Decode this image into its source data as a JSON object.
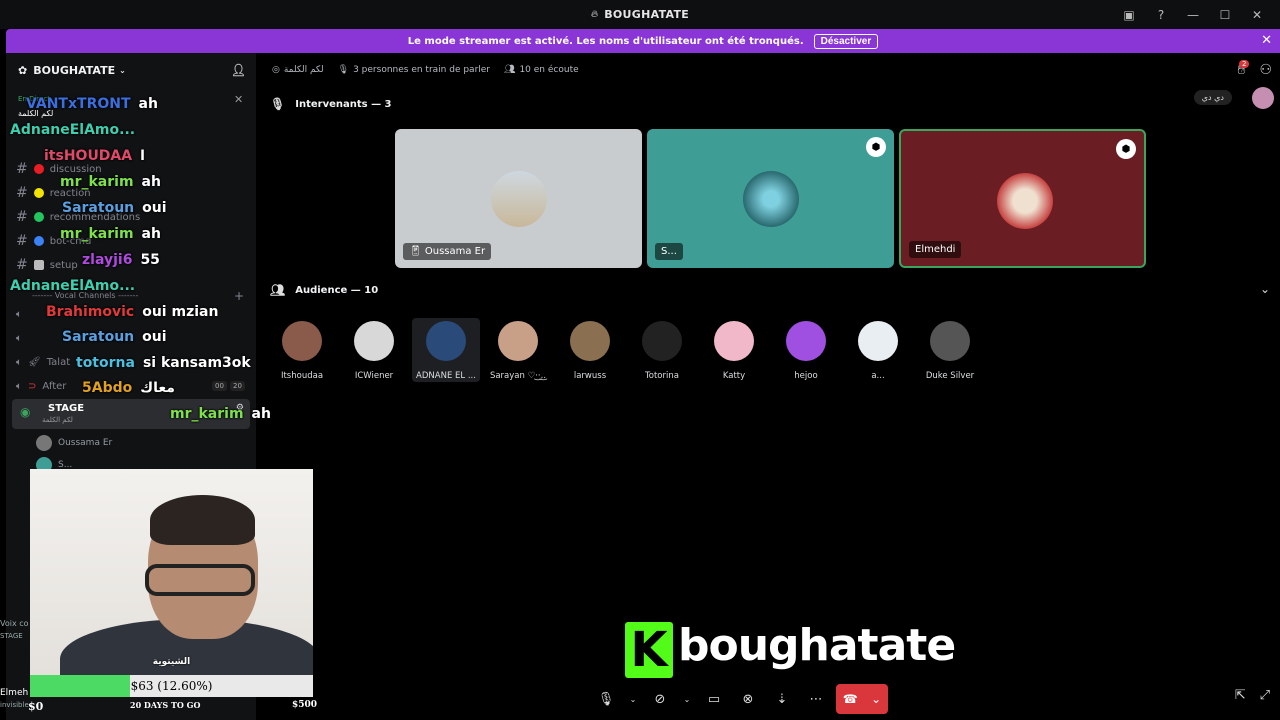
{
  "window": {
    "title": "BOUGHATATE"
  },
  "banner": {
    "text": "Le mode streamer est activé. Les noms d'utilisateur ont été tronqués.",
    "button": "Désactiver"
  },
  "sidebar": {
    "server_name": "BOUGHATATE",
    "live_label": "En Direct",
    "live_channel": "لكم الكلمة",
    "channels": [
      {
        "name": "discussion",
        "color": "#e91e24"
      },
      {
        "name": "reaction",
        "color": "#f2e400"
      },
      {
        "name": "recommendations",
        "color": "#22c55e"
      },
      {
        "name": "bot-cmd",
        "color": "#3b82f6"
      },
      {
        "name": "setup",
        "color": "#bbbbbb"
      }
    ],
    "vocal_header": "------- Vocal Channels -------",
    "voice_channels": [
      "Talat",
      "After"
    ],
    "voice_counts": [
      "00",
      "20"
    ],
    "stage": {
      "label": "STAGE",
      "sub": "لكم الكلمة"
    },
    "stage_users": [
      "Oussama Er",
      "S..."
    ]
  },
  "chat": [
    {
      "user": "VANTxTRONT",
      "msg": "ah",
      "color": "#3b6fe0"
    },
    {
      "user": "AdnaneElAmo...",
      "msg": "",
      "color": "#3ecfae"
    },
    {
      "user": "itsHOUDAA",
      "msg": "ا",
      "color": "#e04a6a"
    },
    {
      "user": "mr_karim",
      "msg": "ah",
      "color": "#7ee04a"
    },
    {
      "user": "Saratoun",
      "msg": "oui",
      "color": "#5aa0e0"
    },
    {
      "user": "mr_karim",
      "msg": "ah",
      "color": "#7ee04a"
    },
    {
      "user": "zlayji6",
      "msg": "55",
      "color": "#b04ae0"
    },
    {
      "user": "AdnaneElAmo...",
      "msg": "",
      "color": "#3ecfae"
    },
    {
      "user": "Brahimovic",
      "msg": "oui mzian",
      "color": "#e03a3a"
    },
    {
      "user": "Saratoun",
      "msg": "oui",
      "color": "#5aa0e0"
    },
    {
      "user": "totorna",
      "msg": "si kansam3ok",
      "color": "#4ac0e0"
    },
    {
      "user": "5Abdo",
      "msg": "معاك",
      "color": "#e0a020"
    },
    {
      "user": "mr_karim",
      "msg": "ah",
      "color": "#7ee04a"
    }
  ],
  "topbar": {
    "channel": "لكم الكلمة",
    "speaking": "3 personnes en train de parler",
    "listening": "10 en écoute",
    "badge": "2",
    "pill": "دي دي"
  },
  "speakers": {
    "header": "Intervenants — 3",
    "items": [
      {
        "name": "Oussama Er",
        "bg": "#c9cccf"
      },
      {
        "name": "S...",
        "bg": "#3e9e96"
      },
      {
        "name": "Elmehdi",
        "bg": "#6a1d22"
      }
    ]
  },
  "audience": {
    "header": "Audience — 10",
    "items": [
      {
        "name": "Itshoudaa",
        "color": "#8a5a4a"
      },
      {
        "name": "ICWiener",
        "color": "#d8d8d8"
      },
      {
        "name": "ADNANE EL ...",
        "color": "#2a4a7a"
      },
      {
        "name": "Sarayan ♡·͜·.͜.",
        "color": "#c8a088"
      },
      {
        "name": "larwuss",
        "color": "#8a7050"
      },
      {
        "name": "Totorina",
        "color": "#222222"
      },
      {
        "name": "Katty",
        "color": "#f0b8c8"
      },
      {
        "name": "hejoo",
        "color": "#a050e0"
      },
      {
        "name": "a...",
        "color": "#e8eef2"
      },
      {
        "name": "Duke Silver",
        "color": "#555555"
      }
    ]
  },
  "webcam": {
    "label": "الشيتوية"
  },
  "goal": {
    "text": "$63 (12.60%)",
    "progress": 0.126,
    "min": "$0",
    "max": "$500",
    "days": "20 DAYS TO GO"
  },
  "left_edge": {
    "voice": "Voix co",
    "stage": "STAGE",
    "user": "Elmeh",
    "status": "invisible"
  },
  "logo": {
    "letter": "K",
    "text": "boughatate"
  }
}
